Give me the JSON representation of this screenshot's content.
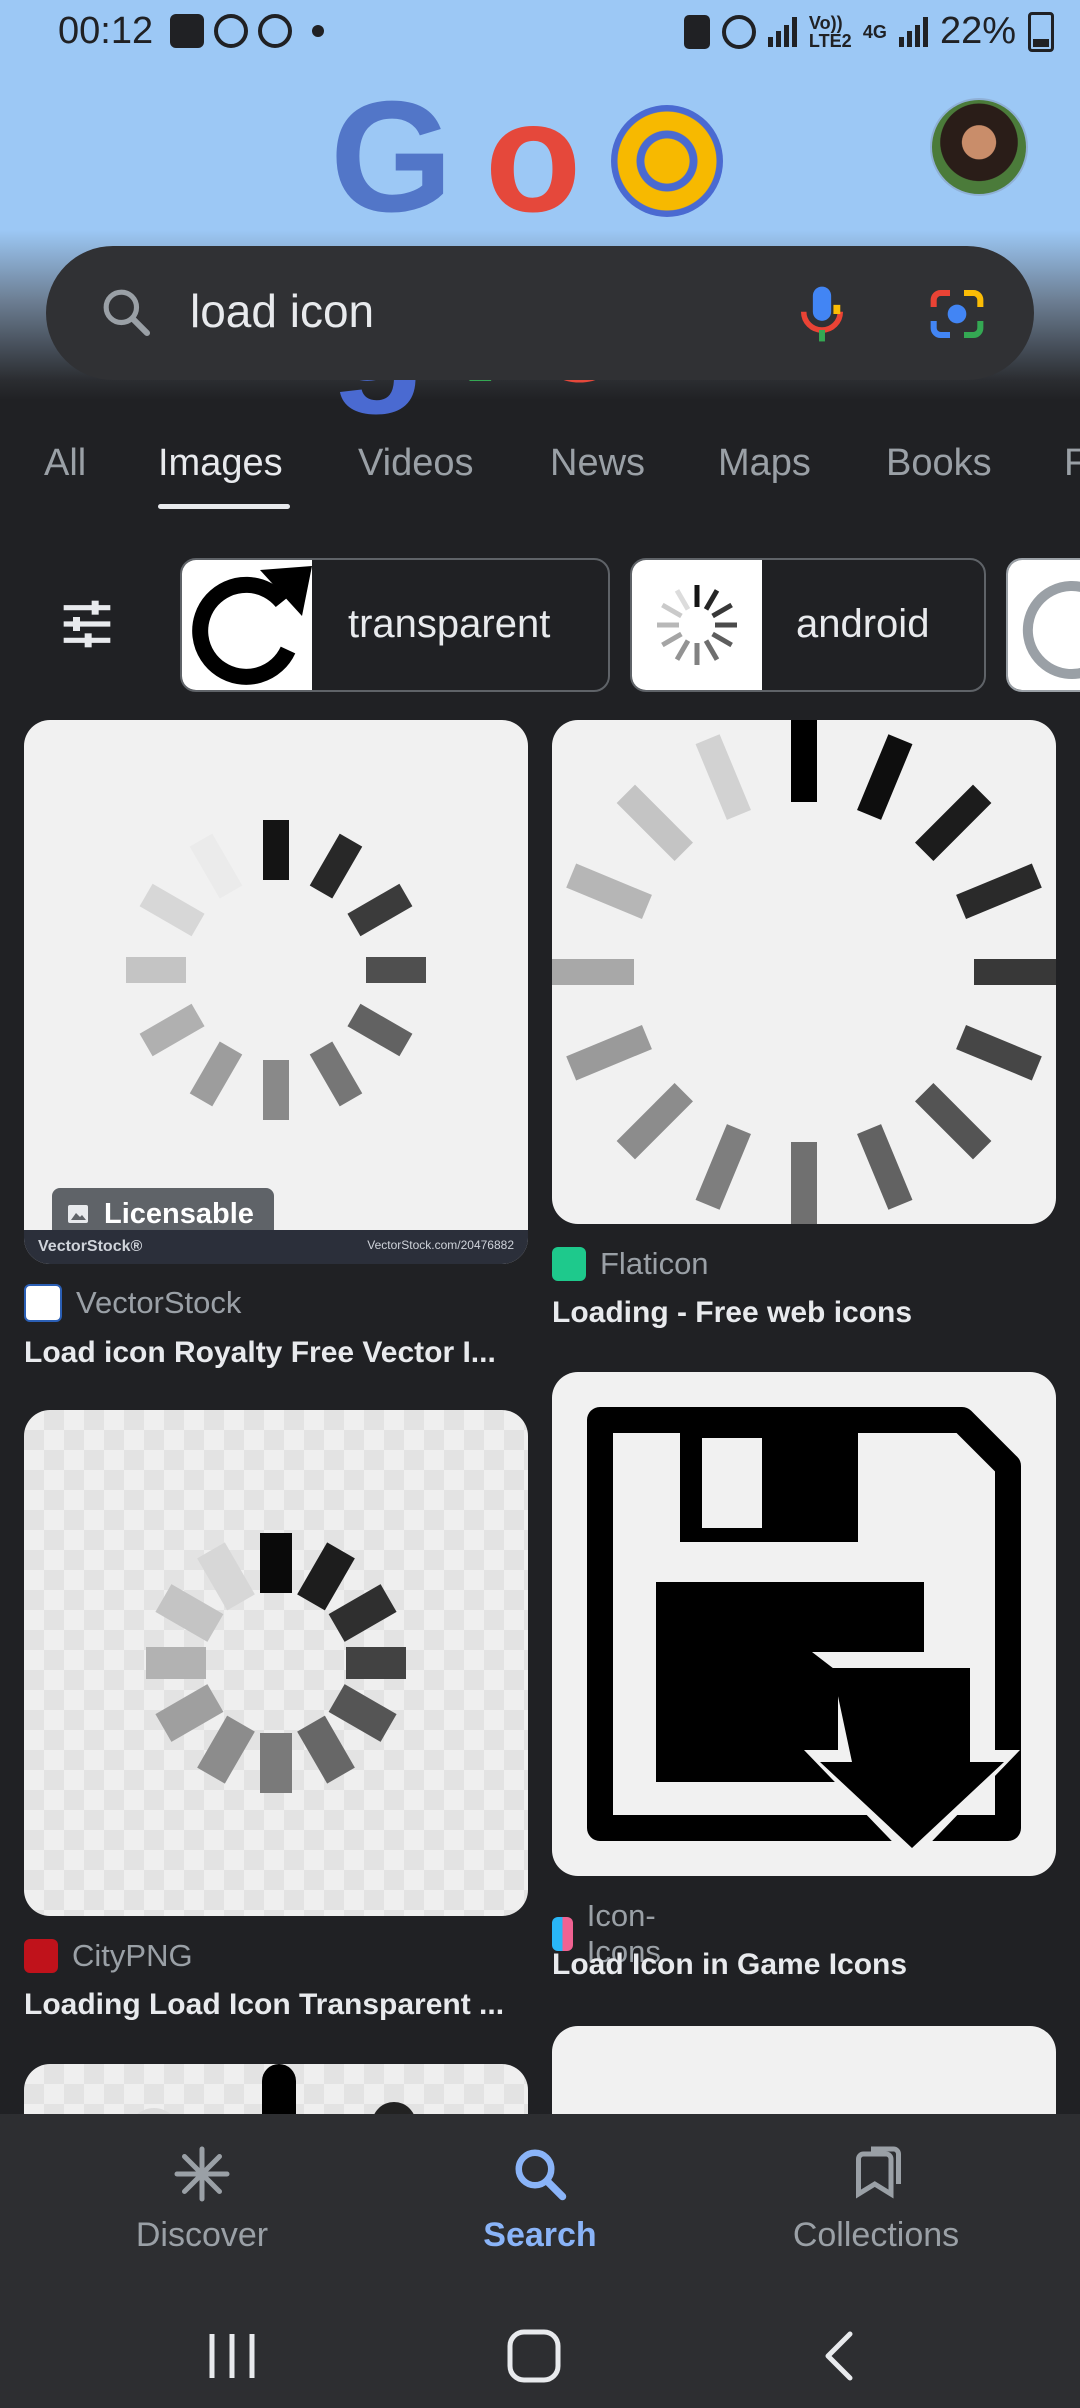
{
  "status_bar": {
    "time": "00:12",
    "network_labels": [
      "Vo)) LTE2",
      "4G"
    ],
    "battery": "22%"
  },
  "header": {
    "logo_letters": [
      "G",
      "o",
      "o",
      "g",
      "l",
      "e"
    ],
    "logo_colors": [
      "#5276c8",
      "#e5483b",
      "#f7b900",
      "#4a6ad1",
      "#34a853",
      "#e5483b"
    ]
  },
  "search": {
    "query": "load icon",
    "icons": [
      "search-icon",
      "mic-icon",
      "lens-icon"
    ]
  },
  "tabs": [
    {
      "label": "All"
    },
    {
      "label": "Images",
      "active": true
    },
    {
      "label": "Videos"
    },
    {
      "label": "News"
    },
    {
      "label": "Maps"
    },
    {
      "label": "Books"
    },
    {
      "label": "F"
    }
  ],
  "filters": {
    "chips": [
      {
        "label": "transparent"
      },
      {
        "label": "android"
      }
    ]
  },
  "results": [
    {
      "source": "VectorStock",
      "title": "Load icon Royalty Free Vector I...",
      "badge": "Licensable",
      "watermark_left": "VectorStock®",
      "watermark_right": "VectorStock.com/20476882"
    },
    {
      "source": "Flaticon",
      "title": "Loading - Free web icons"
    },
    {
      "source": "CityPNG",
      "title": "Loading Load Icon Transparent ..."
    },
    {
      "source": "Icon-Icons",
      "title": "Load Icon in Game Icons"
    }
  ],
  "bottom_nav": {
    "items": [
      {
        "label": "Discover"
      },
      {
        "label": "Search",
        "active": true
      },
      {
        "label": "Collections"
      }
    ]
  },
  "colors": {
    "accent": "#8ab4f8",
    "background": "#202124",
    "header_sky": "#9cc8f5"
  }
}
